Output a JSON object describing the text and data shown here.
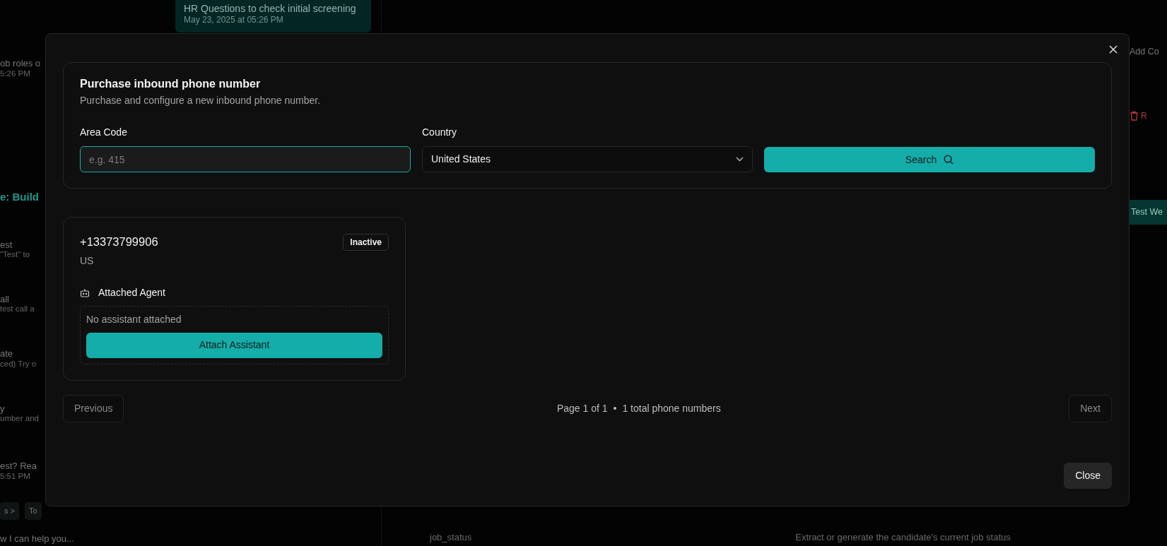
{
  "background": {
    "left_panel": {
      "bubble": {
        "text": "HR Questions to check initial screening",
        "time": "May 23, 2025 at 05:26 PM"
      },
      "message": {
        "text": "ob roles o",
        "time": "5:26 PM"
      },
      "heading": "e: Build",
      "steps": [
        {
          "title": "est",
          "subtitle": "\"Test\" to"
        },
        {
          "title": "all",
          "subtitle": "test call a"
        },
        {
          "title": "ate",
          "subtitle": "ced) Try o"
        },
        {
          "title": "y",
          "subtitle": "umber and"
        }
      ],
      "message_2": {
        "text": "est? Rea",
        "time": "5:51 PM"
      },
      "chips": [
        "s >",
        "To"
      ],
      "input_text": "w I can help you..."
    },
    "right_panel": {
      "add_button": "Add Co",
      "remove_button": "R",
      "test_button": "Test We",
      "field_name": "job_status",
      "field_description": "Extract or generate the candidate's current job status"
    }
  },
  "modal": {
    "purchase": {
      "title": "Purchase inbound phone number",
      "subtitle": "Purchase and configure a new inbound phone number.",
      "area_code": {
        "label": "Area Code",
        "placeholder": "e.g. 415",
        "focused": true
      },
      "country": {
        "label": "Country",
        "value": "United States"
      },
      "search_button": "Search"
    },
    "phone_numbers": [
      {
        "number": "+13373799906",
        "country": "US",
        "status": "Inactive",
        "agent_label": "Attached Agent",
        "agent_empty": "No assistant attached",
        "attach_button": "Attach Assistant"
      }
    ],
    "pagination": {
      "previous": {
        "label": "Previous",
        "disabled": true
      },
      "page_info": "Page 1 of 1",
      "separator": "•",
      "total": "1 total phone numbers",
      "next": {
        "label": "Next",
        "disabled": true
      }
    },
    "close_button": "Close"
  }
}
